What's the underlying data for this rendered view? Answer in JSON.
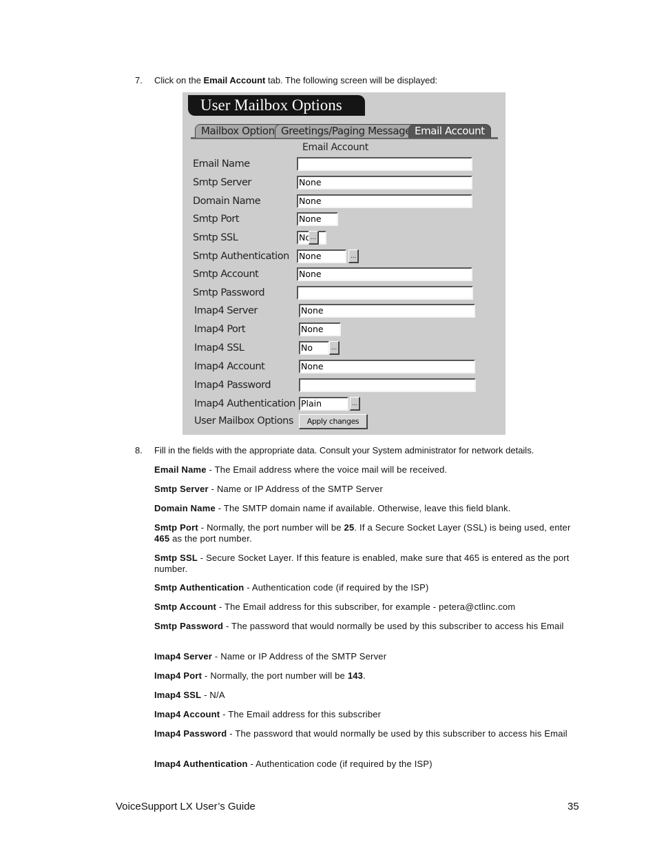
{
  "step7": {
    "number": "7.",
    "pre": "Click on the ",
    "bold": "Email Account",
    "post": " tab. The following screen will be displayed:"
  },
  "screenshot": {
    "title": "User Mailbox Options",
    "tabs": [
      {
        "label": "Mailbox Options",
        "active": false
      },
      {
        "label": "Greetings/Paging Message",
        "active": false
      },
      {
        "label": "Email Account",
        "active": true
      }
    ],
    "section_label": "Email Account",
    "fields": [
      {
        "label": "Email Name",
        "value": "",
        "has_picker": false
      },
      {
        "label": "Smtp Server",
        "value": "None",
        "has_picker": false
      },
      {
        "label": "Domain Name",
        "value": "None",
        "has_picker": false
      },
      {
        "label": "Smtp Port",
        "value": "None",
        "has_picker": false
      },
      {
        "label": "Smtp SSL",
        "value": "No",
        "has_picker": true
      },
      {
        "label": "Smtp Authentication",
        "value": "None",
        "has_picker": true
      },
      {
        "label": "Smtp Account",
        "value": "None",
        "has_picker": false
      },
      {
        "label": "Smtp Password",
        "value": "",
        "has_picker": false
      },
      {
        "label": "Imap4 Server",
        "value": "None",
        "has_picker": false
      },
      {
        "label": "Imap4 Port",
        "value": "None",
        "has_picker": false
      },
      {
        "label": "Imap4 SSL",
        "value": "No",
        "has_picker": true
      },
      {
        "label": "Imap4 Account",
        "value": "None",
        "has_picker": false
      },
      {
        "label": "Imap4 Password",
        "value": "",
        "has_picker": false
      },
      {
        "label": "Imap4 Authentication",
        "value": "Plain",
        "has_picker": true
      }
    ],
    "picker_label": "...",
    "footer_label": "User Mailbox Options",
    "apply_button": "Apply changes"
  },
  "step8": {
    "number": "8.",
    "text": "Fill in the fields with the appropriate data. Consult your System administrator for network details."
  },
  "descriptions": [
    {
      "term": "Email Name",
      "text": " - The Email address where the voice mail will be received."
    },
    {
      "term": "Smtp Server",
      "text": " - Name or IP Address of the SMTP Server"
    },
    {
      "term": "Domain Name",
      "text": " - The SMTP domain name if available. Otherwise, leave this field blank."
    },
    {
      "term": "Smtp Port",
      "text_parts": [
        " - Normally, the port number will be ",
        "25",
        ". If a Secure Socket Layer (SSL) is being used, enter ",
        "465",
        " as the port number."
      ]
    },
    {
      "term": "Smtp SSL",
      "text": " - Secure Socket Layer. If this feature is enabled, make sure that 465 is entered as the port number."
    },
    {
      "term": "Smtp Authentication",
      "text": " - Authentication code (if required by the ISP)"
    },
    {
      "term": "Smtp Account",
      "text": " - The Email address for this subscriber, for example - petera@ctlinc.com"
    },
    {
      "term": "Smtp Password",
      "text": " - The password that would normally be used by this subscriber to access his Email"
    },
    {
      "term": "Imap4 Server",
      "text": " - Name or IP Address of the SMTP Server"
    },
    {
      "term": "Imap4 Port",
      "text_parts": [
        " - Normally, the port number will be ",
        "143",
        "."
      ]
    },
    {
      "term": "Imap4 SSL",
      "text": " - N/A"
    },
    {
      "term": "Imap4 Account",
      "text": " - The Email address for this subscriber"
    },
    {
      "term": "Imap4 Password",
      "text": " - The password that would normally be used by this subscriber to access his Email"
    },
    {
      "term": "Imap4 Authentication",
      "text": " - Authentication code (if required by the ISP)"
    }
  ],
  "footer": {
    "title": "VoiceSupport LX User’s Guide",
    "page": "35"
  }
}
